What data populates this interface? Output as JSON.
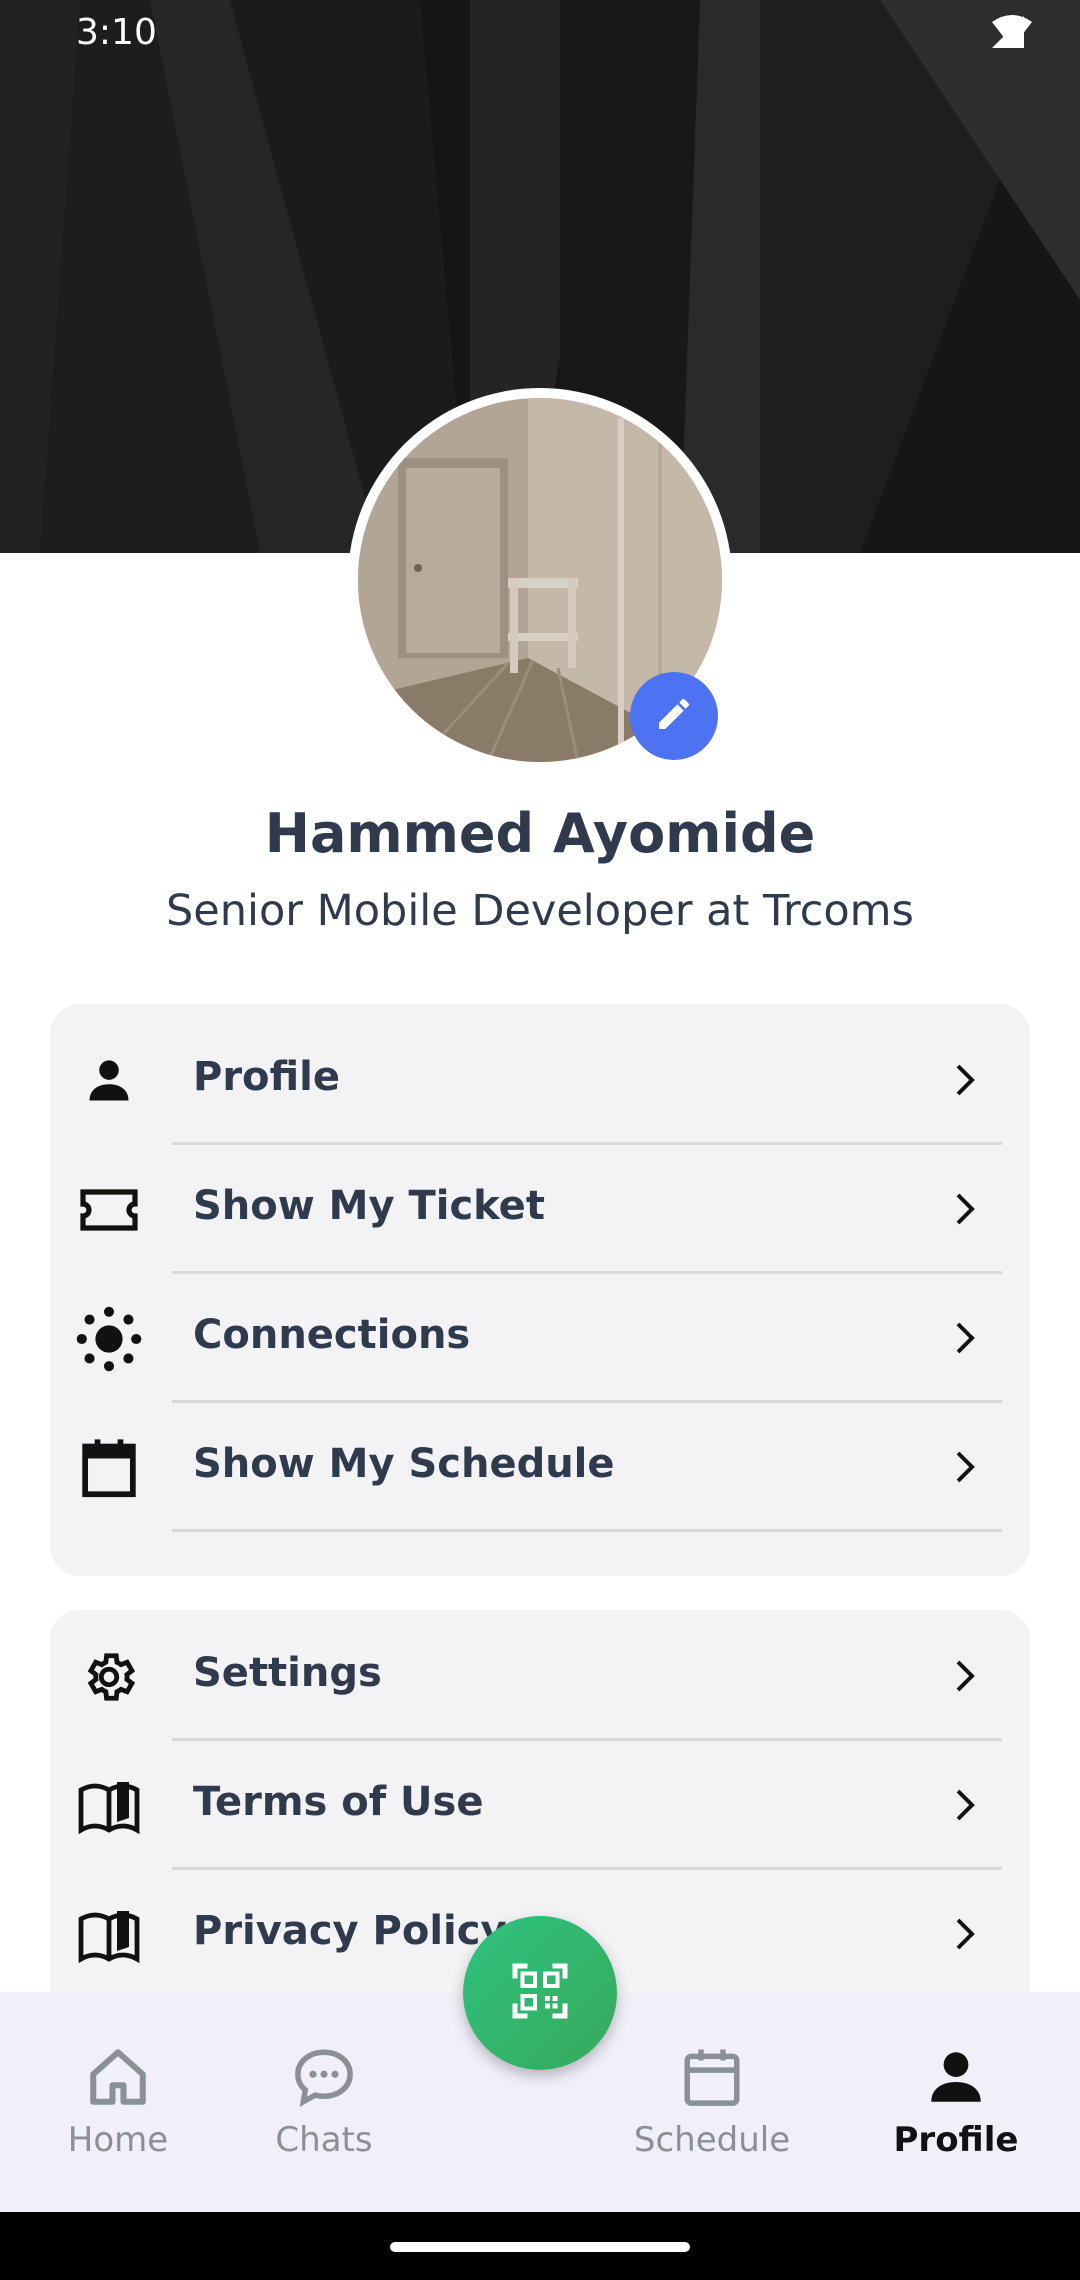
{
  "status_bar": {
    "time": "3:10"
  },
  "profile": {
    "name": "Hammed Ayomide",
    "role": "Senior Mobile Developer at Trcoms"
  },
  "menu_group_1": [
    {
      "label": "Profile",
      "icon": "person-icon"
    },
    {
      "label": "Show My Ticket",
      "icon": "ticket-icon"
    },
    {
      "label": "Connections",
      "icon": "connections-icon"
    },
    {
      "label": "Show My Schedule",
      "icon": "calendar-icon"
    }
  ],
  "menu_group_2": [
    {
      "label": "Settings",
      "icon": "gear-icon"
    },
    {
      "label": "Terms of Use",
      "icon": "book-icon"
    },
    {
      "label": "Privacy Policy",
      "icon": "book-icon"
    }
  ],
  "bottom_nav": {
    "home": "Home",
    "chats": "Chats",
    "schedule": "Schedule",
    "profile": "Profile",
    "active": "profile"
  },
  "colors": {
    "accent_blue": "#4d73f2",
    "fab_green": "#2ec27e",
    "text_dark": "#2f3a4d",
    "card_bg": "#f3f2f5",
    "nav_bg": "#f1f0f9"
  }
}
